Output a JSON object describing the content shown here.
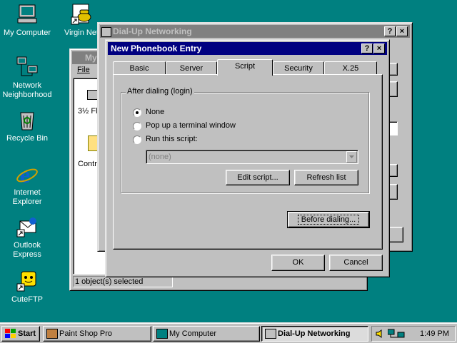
{
  "desktop": {
    "icons": [
      {
        "label": "My Computer"
      },
      {
        "label": "Virgin Net"
      },
      {
        "label": "Network Neighborhood"
      },
      {
        "label": "Recycle Bin"
      },
      {
        "label": "Internet Explorer"
      },
      {
        "label": "Outlook Express"
      },
      {
        "label": "CuteFTP"
      }
    ]
  },
  "my_computer_window": {
    "title": "My",
    "menu_file": "File",
    "item_floppy": "3½ Fl",
    "item_control": "Contr",
    "status": "1 object(s) selected"
  },
  "dun_window": {
    "title": "Dial-Up Networking",
    "help_btn": "?",
    "close_btn": "×"
  },
  "dialog": {
    "title": "New Phonebook Entry",
    "help_btn": "?",
    "close_btn": "×",
    "tabs": [
      "Basic",
      "Server",
      "Script",
      "Security",
      "X.25"
    ],
    "selected_tab": "Script",
    "group_label": "After dialing (login)",
    "options": [
      {
        "label": "None",
        "selected": true
      },
      {
        "label": "Pop up a terminal window",
        "selected": false
      },
      {
        "label": "Run this script:",
        "selected": false
      }
    ],
    "script_select": "(none)",
    "edit_script": "Edit script...",
    "refresh_list": "Refresh list",
    "before_dialing": "Before dialing...",
    "ok": "OK",
    "cancel": "Cancel"
  },
  "taskbar": {
    "start": "Start",
    "items": [
      "Paint Shop Pro",
      "My Computer",
      "Dial-Up Networking"
    ],
    "active_item": "Dial-Up Networking",
    "clock": "1:49 PM"
  },
  "colors": {
    "desktop": "#008080",
    "title_active": "#000080",
    "title_inactive": "#808080",
    "face": "#c0c0c0"
  }
}
